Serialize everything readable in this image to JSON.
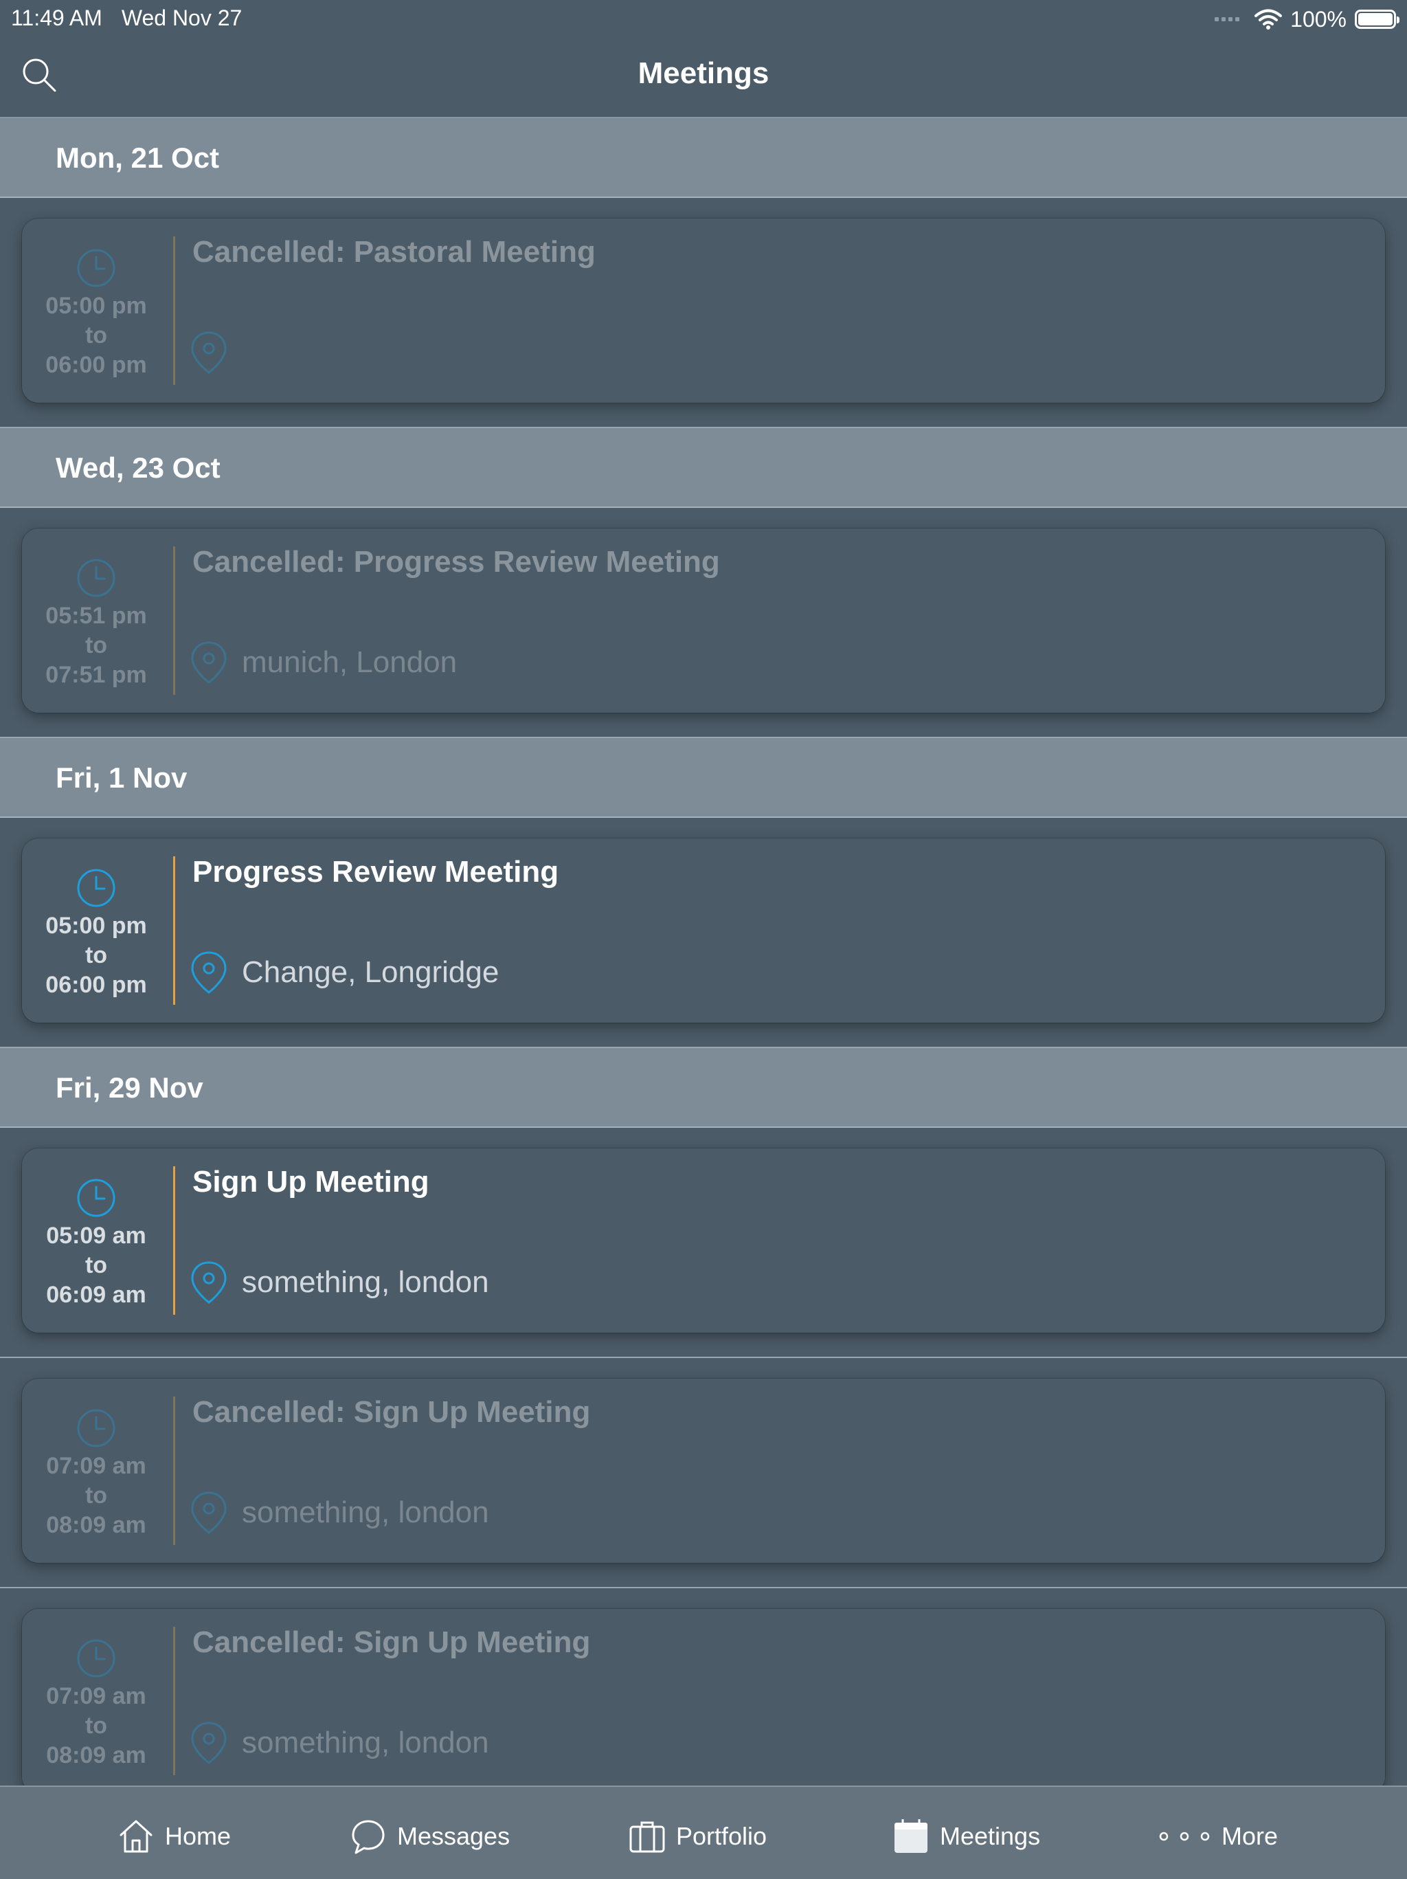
{
  "status_bar": {
    "time": "11:49 AM",
    "date": "Wed Nov 27",
    "battery": "100%"
  },
  "nav": {
    "title": "Meetings"
  },
  "sections": [
    {
      "label": "Mon, 21 Oct"
    },
    {
      "label": "Wed, 23 Oct"
    },
    {
      "label": "Fri, 1 Nov"
    },
    {
      "label": "Fri, 29 Nov"
    }
  ],
  "meetings": [
    {
      "title": "Cancelled: Pastoral Meeting",
      "start": "05:00 pm",
      "to": "to",
      "end": "06:00 pm",
      "location": "",
      "cancelled": true
    },
    {
      "title": "Cancelled: Progress Review Meeting",
      "start": "05:51 pm",
      "to": "to",
      "end": "07:51 pm",
      "location": "munich, London",
      "cancelled": true
    },
    {
      "title": "Progress Review Meeting",
      "start": "05:00 pm",
      "to": "to",
      "end": "06:00 pm",
      "location": "Change, Longridge",
      "cancelled": false
    },
    {
      "title": "Sign Up Meeting",
      "start": "05:09 am",
      "to": "to",
      "end": "06:09 am",
      "location": "something, london",
      "cancelled": false
    },
    {
      "title": "Cancelled: Sign Up Meeting",
      "start": "07:09 am",
      "to": "to",
      "end": "08:09 am",
      "location": "something, london",
      "cancelled": true
    },
    {
      "title": "Cancelled: Sign Up Meeting",
      "start": "07:09 am",
      "to": "to",
      "end": "08:09 am",
      "location": "something, london",
      "cancelled": true
    }
  ],
  "tabs": [
    {
      "label": "Home",
      "icon": "home-icon"
    },
    {
      "label": "Messages",
      "icon": "chat-bubble-icon"
    },
    {
      "label": "Portfolio",
      "icon": "briefcase-icon"
    },
    {
      "label": "Meetings",
      "icon": "calendar-icon",
      "selected": true
    },
    {
      "label": "More",
      "icon": "more-dots-icon"
    }
  ],
  "colors": {
    "accent_blue": "#1e9fdc",
    "divider_orange": "#e6a23c",
    "background": "#4b5b67",
    "section_header": "#7e8c97",
    "tab_bar": "#65737e"
  }
}
